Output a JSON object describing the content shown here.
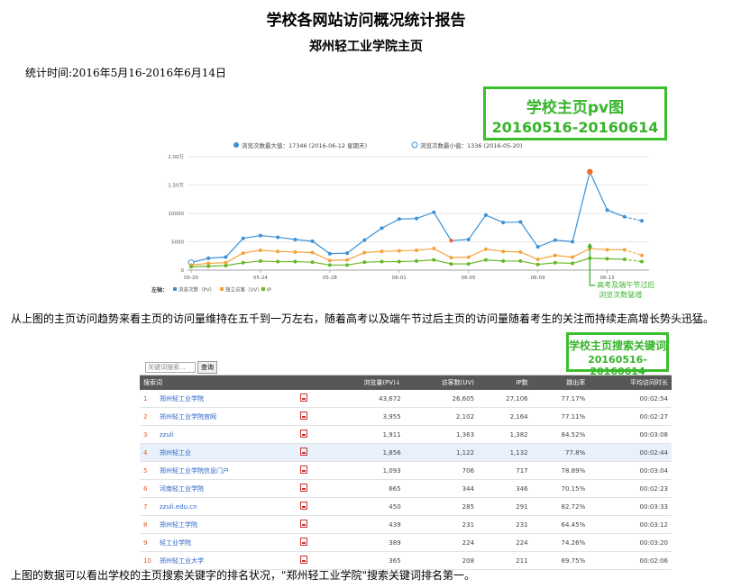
{
  "header": {
    "title": "学校各网站访问概况统计报告",
    "subtitle": "郑州轻工业学院主页",
    "stat_time": "统计时间:2016年5月16-2016年6月14日"
  },
  "pv_box": {
    "line1": "学校主页pv图",
    "line2": "20160516-20160614"
  },
  "kw_box": {
    "line1": "学校主页搜索关键词",
    "line2": "20160516-20160614"
  },
  "chart_data": {
    "type": "line",
    "legend": [
      {
        "text": "浏览次数最大值：17346 (2016-06-12 星期天)",
        "color": "#3a91d8"
      },
      {
        "text": "浏览次数最小值：1336 (2016-05-20)",
        "color": "#3a91d8"
      }
    ],
    "yticks": [
      "2.00万",
      "1.50万",
      "10000",
      "5000",
      "0"
    ],
    "ylim": [
      0,
      20000
    ],
    "xticks": [
      "05-20",
      "05-24",
      "05-28",
      "06-01",
      "06-05",
      "06-09",
      "06-13"
    ],
    "x_start": "05-20",
    "bottom_legend": {
      "label": "左轴：",
      "items": [
        "浏览次数（PV）",
        "独立访客（UV）",
        "IP"
      ]
    },
    "series": [
      {
        "name": "浏览次数（PV）",
        "color": "#3a91d8",
        "values": [
          1336,
          2100,
          2300,
          5600,
          6100,
          5800,
          5400,
          5100,
          2900,
          3000,
          5300,
          7400,
          9000,
          9100,
          10200,
          5200,
          5400,
          9700,
          8400,
          8500,
          4100,
          5300,
          5000,
          17346,
          10600,
          9400,
          8700
        ]
      },
      {
        "name": "独立访客（UV）",
        "color": "#f5a23c",
        "values": [
          900,
          1200,
          1300,
          3000,
          3500,
          3300,
          3200,
          3100,
          1700,
          1800,
          3100,
          3300,
          3400,
          3500,
          3800,
          2200,
          2300,
          3700,
          3300,
          3200,
          1900,
          2600,
          2300,
          3800,
          3600,
          3600,
          2600
        ]
      },
      {
        "name": "IP",
        "color": "#68b828",
        "values": [
          600,
          700,
          800,
          1300,
          1600,
          1500,
          1500,
          1400,
          900,
          900,
          1400,
          1500,
          1500,
          1600,
          1800,
          1100,
          1100,
          1800,
          1600,
          1600,
          1000,
          1300,
          1200,
          2100,
          2000,
          1900,
          1500
        ]
      }
    ],
    "annotation": "高考及端午节过后\n浏览次数猛增"
  },
  "paragraphs": {
    "p1": "从上图的主页访问趋势来看主页的访问量维持在五千到一万左右，随着高考以及端午节过后主页的访问量随着考生的关注而持续走高增长势头迅猛。",
    "p2": "上图的数据可以看出学校的主页搜索关键字的排名状况，\"郑州轻工业学院\"搜索关键词排名第一。"
  },
  "kw_table": {
    "search_placeholder": "关键词搜索...",
    "search_button": "查询",
    "headers": [
      "搜索词",
      "浏览量(PV)↓",
      "访客数(UV)",
      "IP数",
      "跳出率",
      "平均访问时长"
    ],
    "rows": [
      {
        "rank": "1",
        "kw": "郑州轻工业学院",
        "pv": "43,672",
        "uv": "26,605",
        "ip": "27,106",
        "bounce": "77.17%",
        "dur": "00:02:54"
      },
      {
        "rank": "2",
        "kw": "郑州轻工业学院官网",
        "pv": "3,955",
        "uv": "2,102",
        "ip": "2,164",
        "bounce": "77.11%",
        "dur": "00:02:27"
      },
      {
        "rank": "3",
        "kw": "zzuli",
        "pv": "1,911",
        "uv": "1,363",
        "ip": "1,382",
        "bounce": "84.52%",
        "dur": "00:03:08"
      },
      {
        "rank": "4",
        "kw": "郑州轻工业",
        "pv": "1,856",
        "uv": "1,122",
        "ip": "1,132",
        "bounce": "77.8%",
        "dur": "00:02:44"
      },
      {
        "rank": "5",
        "kw": "郑州轻工业学院信息门户",
        "pv": "1,093",
        "uv": "706",
        "ip": "717",
        "bounce": "78.89%",
        "dur": "00:03:04"
      },
      {
        "rank": "6",
        "kw": "河南轻工业学院",
        "pv": "665",
        "uv": "344",
        "ip": "346",
        "bounce": "70.15%",
        "dur": "00:02:23"
      },
      {
        "rank": "7",
        "kw": "zzuli.edu.cn",
        "pv": "450",
        "uv": "285",
        "ip": "291",
        "bounce": "82.72%",
        "dur": "00:03:33"
      },
      {
        "rank": "8",
        "kw": "郑州轻工学院",
        "pv": "439",
        "uv": "231",
        "ip": "231",
        "bounce": "64.45%",
        "dur": "00:03:12"
      },
      {
        "rank": "9",
        "kw": "轻工业学院",
        "pv": "389",
        "uv": "224",
        "ip": "224",
        "bounce": "74.26%",
        "dur": "00:03:20"
      },
      {
        "rank": "10",
        "kw": "郑州轻工业大学",
        "pv": "365",
        "uv": "208",
        "ip": "211",
        "bounce": "69.75%",
        "dur": "00:02:06"
      }
    ]
  }
}
